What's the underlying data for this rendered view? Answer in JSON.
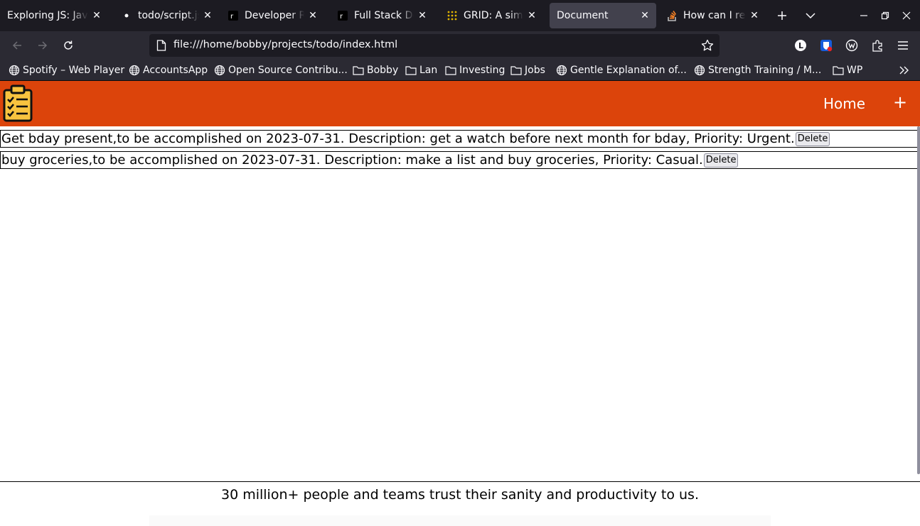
{
  "browser": {
    "tabs": [
      {
        "title": "Exploring JS: JavaScript",
        "icon": "none"
      },
      {
        "title": "todo/script.js at main",
        "icon": "github-icon"
      },
      {
        "title": "Developer Roadmaps",
        "icon": "roadmap-icon"
      },
      {
        "title": "Full Stack Developer",
        "icon": "roadmap-icon"
      },
      {
        "title": "GRID: A simple visual",
        "icon": "grid-icon"
      },
      {
        "title": "Document",
        "icon": "none",
        "active": true
      },
      {
        "title": "How can I remove",
        "icon": "stackoverflow-icon"
      }
    ],
    "url": "file:///home/bobby/projects/todo/index.html",
    "bookmarks": [
      {
        "label": "Spotify – Web Player",
        "icon": "globe-icon"
      },
      {
        "label": "AccountsApp",
        "icon": "globe-icon"
      },
      {
        "label": "Open Source Contribu...",
        "icon": "globe-icon"
      },
      {
        "label": "Bobby",
        "icon": "folder-icon"
      },
      {
        "label": "Lan",
        "icon": "folder-icon"
      },
      {
        "label": "Investing",
        "icon": "folder-icon"
      },
      {
        "label": "Jobs",
        "icon": "folder-icon"
      },
      {
        "label": "Gentle Explanation of...",
        "icon": "globe-icon"
      },
      {
        "label": "Strength Training / M...",
        "icon": "globe-icon"
      },
      {
        "label": "WP",
        "icon": "folder-icon"
      }
    ]
  },
  "app": {
    "header_color": "#dc440b",
    "nav": {
      "home_label": "Home",
      "add_label": "+"
    },
    "todos": [
      {
        "text": "Get bday present,to be accomplished on 2023-07-31. Description: get a watch before next month for bday, Priority: Urgent.",
        "delete_label": "Delete"
      },
      {
        "text": "buy groceries,to be accomplished on 2023-07-31. Description: make a list and buy groceries, Priority: Casual.",
        "delete_label": "Delete"
      }
    ],
    "footer_text": "30 million+ people and teams trust their sanity and productivity to us."
  }
}
